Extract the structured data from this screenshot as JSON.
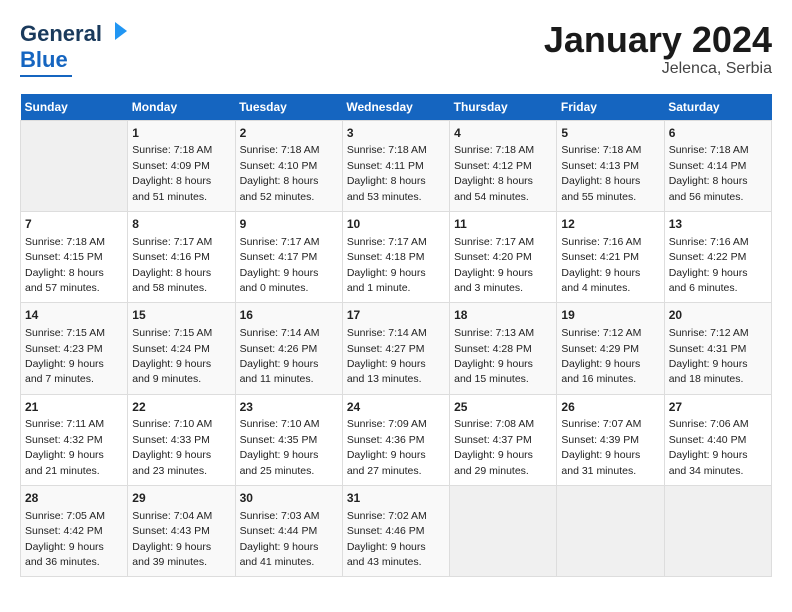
{
  "header": {
    "logo": {
      "line1": "General",
      "line2": "Blue"
    },
    "title": "January 2024",
    "subtitle": "Jelenca, Serbia"
  },
  "weekdays": [
    "Sunday",
    "Monday",
    "Tuesday",
    "Wednesday",
    "Thursday",
    "Friday",
    "Saturday"
  ],
  "weeks": [
    [
      {
        "day": "",
        "info": ""
      },
      {
        "day": "1",
        "info": "Sunrise: 7:18 AM\nSunset: 4:09 PM\nDaylight: 8 hours\nand 51 minutes."
      },
      {
        "day": "2",
        "info": "Sunrise: 7:18 AM\nSunset: 4:10 PM\nDaylight: 8 hours\nand 52 minutes."
      },
      {
        "day": "3",
        "info": "Sunrise: 7:18 AM\nSunset: 4:11 PM\nDaylight: 8 hours\nand 53 minutes."
      },
      {
        "day": "4",
        "info": "Sunrise: 7:18 AM\nSunset: 4:12 PM\nDaylight: 8 hours\nand 54 minutes."
      },
      {
        "day": "5",
        "info": "Sunrise: 7:18 AM\nSunset: 4:13 PM\nDaylight: 8 hours\nand 55 minutes."
      },
      {
        "day": "6",
        "info": "Sunrise: 7:18 AM\nSunset: 4:14 PM\nDaylight: 8 hours\nand 56 minutes."
      }
    ],
    [
      {
        "day": "7",
        "info": "Sunrise: 7:18 AM\nSunset: 4:15 PM\nDaylight: 8 hours\nand 57 minutes."
      },
      {
        "day": "8",
        "info": "Sunrise: 7:17 AM\nSunset: 4:16 PM\nDaylight: 8 hours\nand 58 minutes."
      },
      {
        "day": "9",
        "info": "Sunrise: 7:17 AM\nSunset: 4:17 PM\nDaylight: 9 hours\nand 0 minutes."
      },
      {
        "day": "10",
        "info": "Sunrise: 7:17 AM\nSunset: 4:18 PM\nDaylight: 9 hours\nand 1 minute."
      },
      {
        "day": "11",
        "info": "Sunrise: 7:17 AM\nSunset: 4:20 PM\nDaylight: 9 hours\nand 3 minutes."
      },
      {
        "day": "12",
        "info": "Sunrise: 7:16 AM\nSunset: 4:21 PM\nDaylight: 9 hours\nand 4 minutes."
      },
      {
        "day": "13",
        "info": "Sunrise: 7:16 AM\nSunset: 4:22 PM\nDaylight: 9 hours\nand 6 minutes."
      }
    ],
    [
      {
        "day": "14",
        "info": "Sunrise: 7:15 AM\nSunset: 4:23 PM\nDaylight: 9 hours\nand 7 minutes."
      },
      {
        "day": "15",
        "info": "Sunrise: 7:15 AM\nSunset: 4:24 PM\nDaylight: 9 hours\nand 9 minutes."
      },
      {
        "day": "16",
        "info": "Sunrise: 7:14 AM\nSunset: 4:26 PM\nDaylight: 9 hours\nand 11 minutes."
      },
      {
        "day": "17",
        "info": "Sunrise: 7:14 AM\nSunset: 4:27 PM\nDaylight: 9 hours\nand 13 minutes."
      },
      {
        "day": "18",
        "info": "Sunrise: 7:13 AM\nSunset: 4:28 PM\nDaylight: 9 hours\nand 15 minutes."
      },
      {
        "day": "19",
        "info": "Sunrise: 7:12 AM\nSunset: 4:29 PM\nDaylight: 9 hours\nand 16 minutes."
      },
      {
        "day": "20",
        "info": "Sunrise: 7:12 AM\nSunset: 4:31 PM\nDaylight: 9 hours\nand 18 minutes."
      }
    ],
    [
      {
        "day": "21",
        "info": "Sunrise: 7:11 AM\nSunset: 4:32 PM\nDaylight: 9 hours\nand 21 minutes."
      },
      {
        "day": "22",
        "info": "Sunrise: 7:10 AM\nSunset: 4:33 PM\nDaylight: 9 hours\nand 23 minutes."
      },
      {
        "day": "23",
        "info": "Sunrise: 7:10 AM\nSunset: 4:35 PM\nDaylight: 9 hours\nand 25 minutes."
      },
      {
        "day": "24",
        "info": "Sunrise: 7:09 AM\nSunset: 4:36 PM\nDaylight: 9 hours\nand 27 minutes."
      },
      {
        "day": "25",
        "info": "Sunrise: 7:08 AM\nSunset: 4:37 PM\nDaylight: 9 hours\nand 29 minutes."
      },
      {
        "day": "26",
        "info": "Sunrise: 7:07 AM\nSunset: 4:39 PM\nDaylight: 9 hours\nand 31 minutes."
      },
      {
        "day": "27",
        "info": "Sunrise: 7:06 AM\nSunset: 4:40 PM\nDaylight: 9 hours\nand 34 minutes."
      }
    ],
    [
      {
        "day": "28",
        "info": "Sunrise: 7:05 AM\nSunset: 4:42 PM\nDaylight: 9 hours\nand 36 minutes."
      },
      {
        "day": "29",
        "info": "Sunrise: 7:04 AM\nSunset: 4:43 PM\nDaylight: 9 hours\nand 39 minutes."
      },
      {
        "day": "30",
        "info": "Sunrise: 7:03 AM\nSunset: 4:44 PM\nDaylight: 9 hours\nand 41 minutes."
      },
      {
        "day": "31",
        "info": "Sunrise: 7:02 AM\nSunset: 4:46 PM\nDaylight: 9 hours\nand 43 minutes."
      },
      {
        "day": "",
        "info": ""
      },
      {
        "day": "",
        "info": ""
      },
      {
        "day": "",
        "info": ""
      }
    ]
  ]
}
